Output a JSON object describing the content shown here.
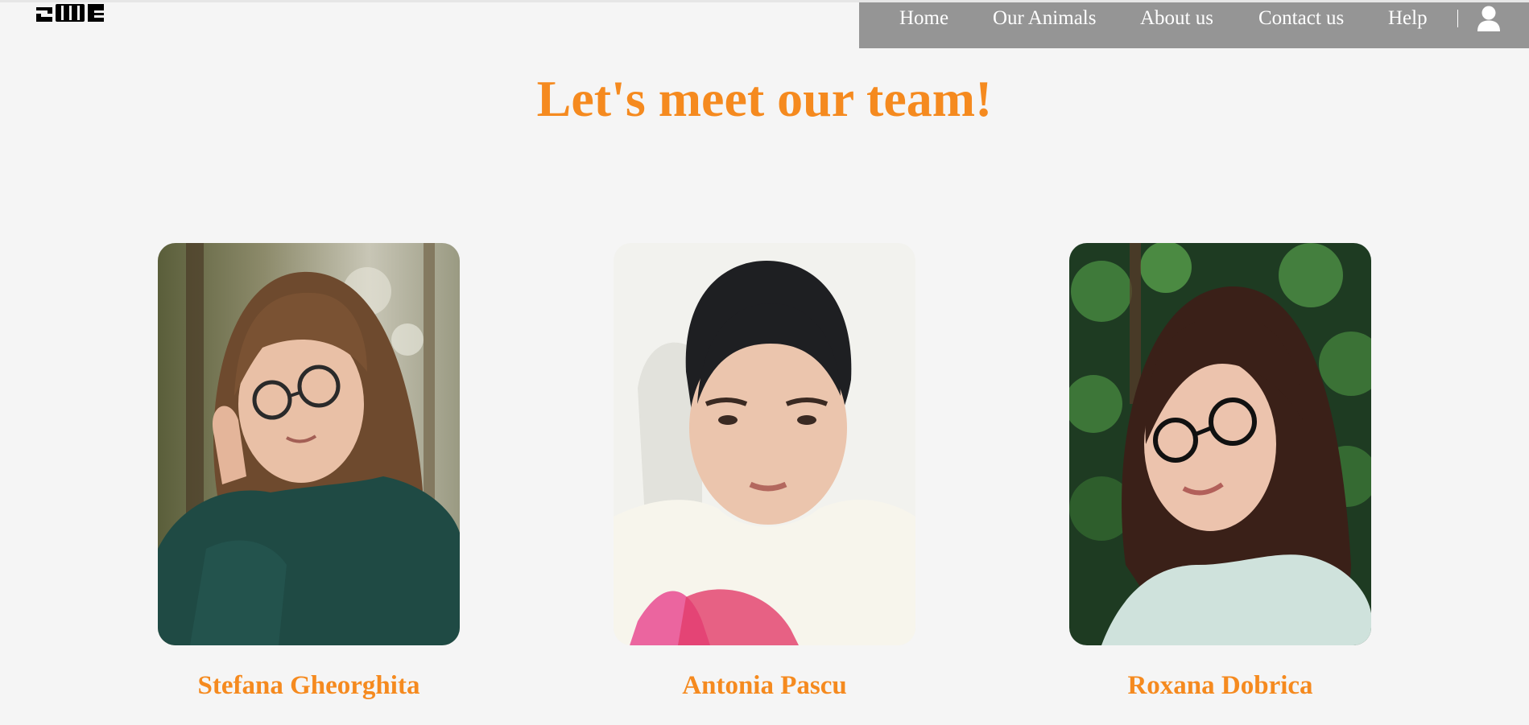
{
  "nav": {
    "items": [
      {
        "label": "Home"
      },
      {
        "label": "Our Animals"
      },
      {
        "label": "About us"
      },
      {
        "label": "Contact us"
      },
      {
        "label": "Help"
      }
    ]
  },
  "main": {
    "title": "Let's meet our team!"
  },
  "team": [
    {
      "name": "Stefana Gheorghita"
    },
    {
      "name": "Antonia Pascu"
    },
    {
      "name": "Roxana Dobrica"
    }
  ],
  "colors": {
    "accent": "#f58a1f",
    "nav_bg": "#959595",
    "page_bg": "#f5f5f5"
  }
}
